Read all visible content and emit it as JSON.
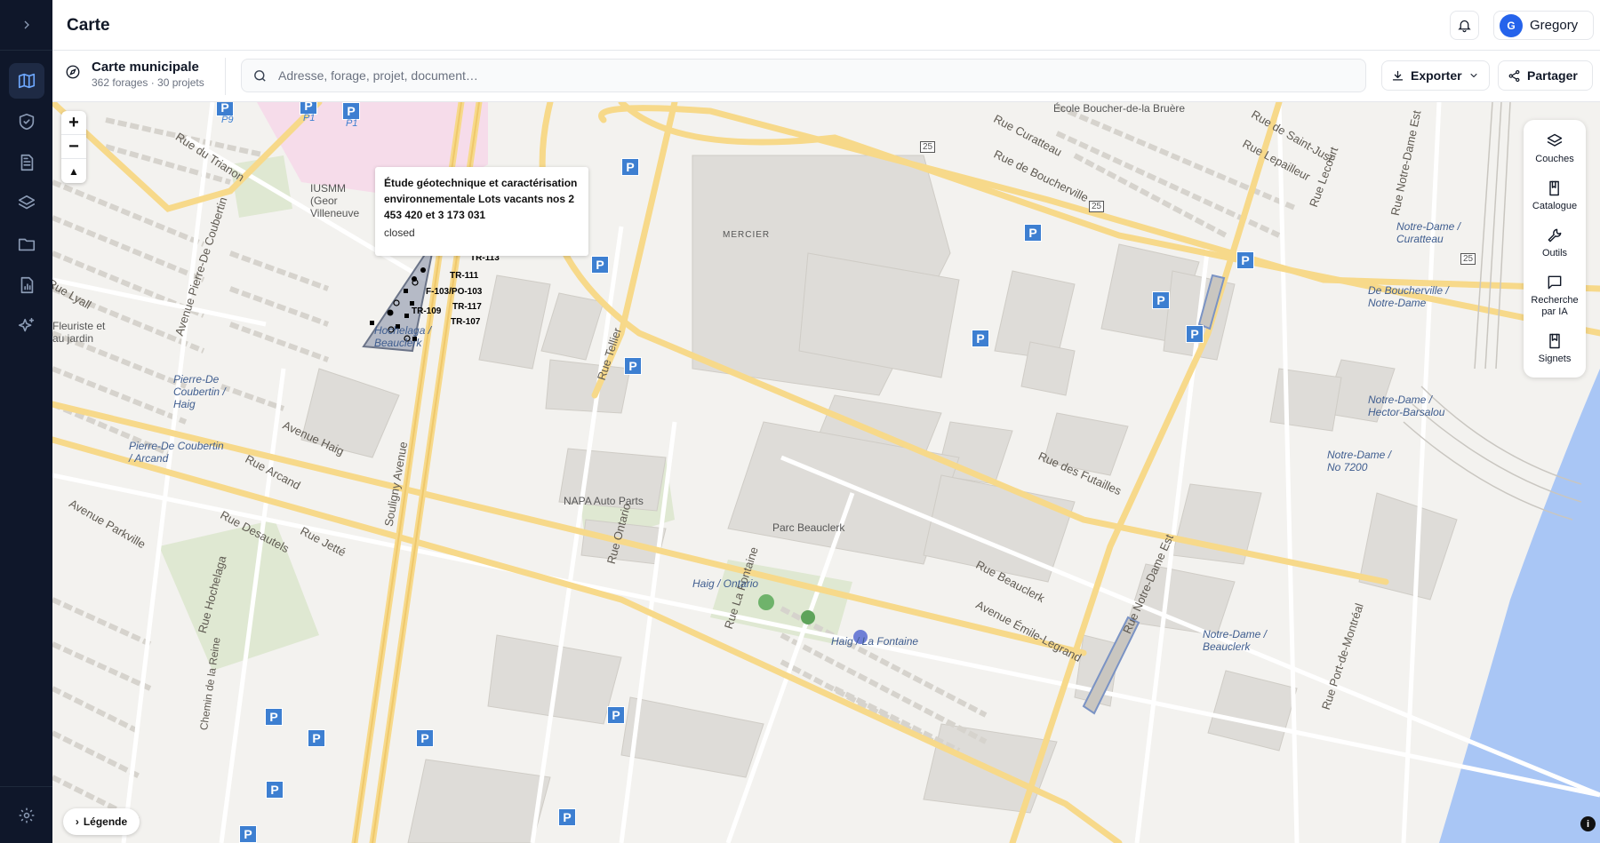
{
  "header": {
    "title": "Carte",
    "user": {
      "initial": "G",
      "name": "Gregory"
    }
  },
  "map_info": {
    "name": "Carte municipale",
    "stats": "362 forages · 30 projets"
  },
  "search": {
    "placeholder": "Adresse, forage, projet, document…"
  },
  "actions": {
    "export_label": "Exporter",
    "share_label": "Partager"
  },
  "zoom": {
    "in": "+",
    "out": "−"
  },
  "popup": {
    "title": "Étude géotechnique et caractérisation environnementale Lots vacants nos 2 453 420 et 3 173 031",
    "status": "closed"
  },
  "tools": [
    {
      "label": "Couches",
      "icon": "layers-icon"
    },
    {
      "label": "Catalogue",
      "icon": "book-icon"
    },
    {
      "label": "Outils",
      "icon": "wrench-icon"
    },
    {
      "label": "Recherche par IA",
      "icon": "chat-icon"
    },
    {
      "label": "Signets",
      "icon": "bookmark-icon"
    }
  ],
  "legend": {
    "label": "Légende"
  },
  "boreholes": [
    "TR-113",
    "TR-111",
    "F-103/PO-103",
    "TR-117",
    "TR-109",
    "TR-107"
  ],
  "streets": [
    "Rue du Trianon",
    "Avenue Pierre-De Coubertin",
    "Rue Lyall",
    "Avenue Haig",
    "Rue Arcand",
    "Avenue Parkville",
    "Rue Desautels",
    "Rue Jetté",
    "Rue Hochelaga",
    "Chemin de la Reine",
    "Souligny Avenue",
    "Rue Curatteau",
    "Rue de Boucherville",
    "Rue Tellier",
    "Rue des Futailles",
    "Rue Ontario",
    "Rue La Fontaine",
    "Rue Beauclerk",
    "Avenue Émile-Legrand",
    "Rue Notre-Dame Est",
    "Rue Port-de-Montréal",
    "Rue Lepailleur",
    "Rue de Saint-Just",
    "Rue Lecourt",
    "Rue Notre-Dame Est"
  ],
  "places": [
    "École Boucher-de-la Bruère",
    "MERCIER",
    "NAPA Auto Parts",
    "Parc Beauclerk",
    "IUSMM (Geor Villeneuve",
    "Fleuriste et au jardin"
  ],
  "bus_stops": [
    "Hochelaga / Beauclerk",
    "Pierre-De Coubertin / Haig",
    "Pierre-De Coubertin / Arcand",
    "Haig / Ontario",
    "Haig / La Fontaine",
    "Notre-Dame / Curatteau",
    "De Boucherville / Notre-Dame",
    "Notre-Dame / Hector-Barsalou",
    "Notre-Dame / No 7200",
    "Notre-Dame / Beauclerk"
  ],
  "parking_labels": [
    "P9",
    "P1",
    "P1"
  ],
  "route_shields": [
    "25",
    "25",
    "25"
  ],
  "colors": {
    "accent": "#2563eb",
    "rail": "#0f172a",
    "road_major": "#f7d98a",
    "park": "#dfe8d2",
    "water": "#a9c6f5",
    "parking": "#3d7fd1"
  }
}
